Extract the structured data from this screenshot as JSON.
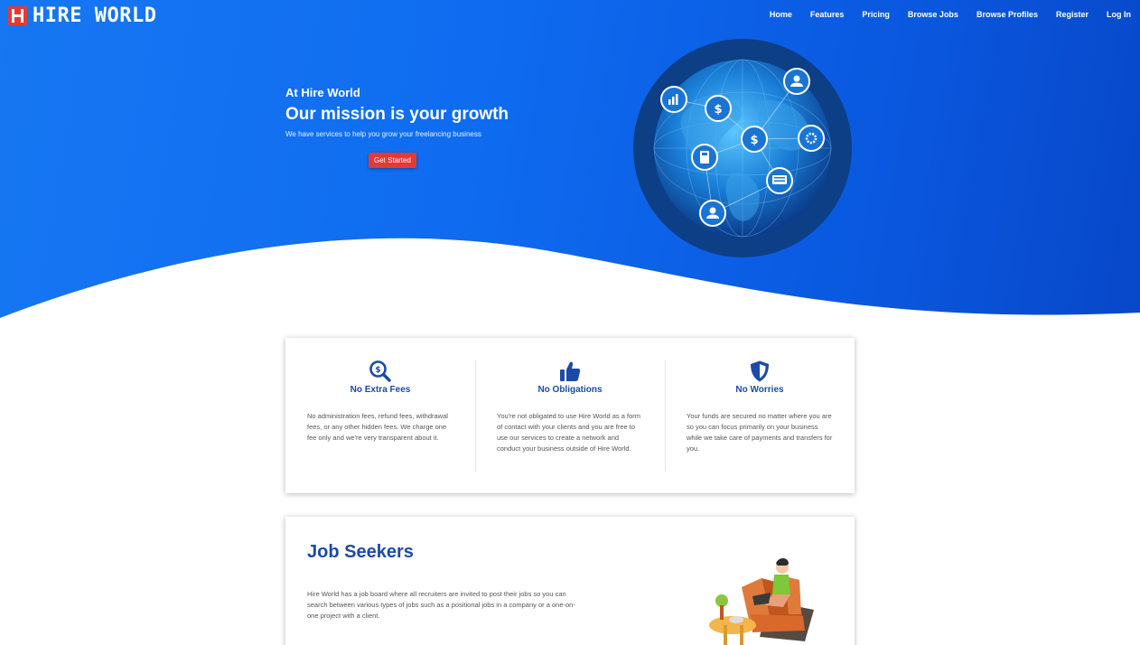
{
  "brand": {
    "name": "HIRE WORLD",
    "accent": "#e53935",
    "primary": "#0f6cf0"
  },
  "nav": {
    "items": [
      "Home",
      "Features",
      "Pricing",
      "Browse Jobs",
      "Browse Profiles",
      "Register",
      "Log In"
    ]
  },
  "hero": {
    "subtitle": "At Hire World",
    "title": "Our mission is your growth",
    "description": "We have services to help you grow your freelancing business",
    "cta_label": "Get Started"
  },
  "features": [
    {
      "icon": "magnifier-dollar-icon",
      "title": "No Extra Fees",
      "text": "No administration fees, refund fees, withdrawal fees, or any other hidden fees. We charge one fee only and we're very transparent about it."
    },
    {
      "icon": "thumbs-up-icon",
      "title": "No Obligations",
      "text": "You're not obligated to use Hire World as a form of contact with your clients and you are free to use our services to create a network and conduct your business outside of Hire World."
    },
    {
      "icon": "shield-icon",
      "title": "No Worries",
      "text": "Your funds are secured no matter where you are so you can focus primarily on your business while we take care of payments and transfers for you."
    }
  ],
  "job_seekers": {
    "title": "Job Seekers",
    "text": "Hire World has a job board where all recruiters are invited to post their jobs so you can search between various types of jobs such as a positional jobs in a company or a one-on-one project with a client."
  }
}
